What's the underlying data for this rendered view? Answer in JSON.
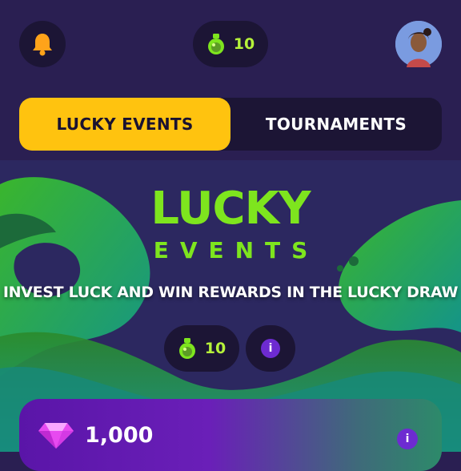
{
  "header": {
    "potion_count": "10",
    "icons": {
      "notifications": "bell-icon",
      "potion": "potion-icon",
      "avatar": "user-avatar"
    }
  },
  "tabs": [
    {
      "label": "LUCKY EVENTS",
      "active": true
    },
    {
      "label": "TOURNAMENTS",
      "active": false
    }
  ],
  "hero": {
    "title_line1": "LUCKY",
    "title_line2": "EVENTS",
    "tagline": "INVEST LUCK AND WIN REWARDS IN THE LUCKY DRAW",
    "luck_count": "10",
    "info_label": "i"
  },
  "reward_card": {
    "amount": "1,000",
    "info_label": "i",
    "icon": "gem-icon"
  },
  "colors": {
    "background": "#2a1f52",
    "panel": "#1c1535",
    "accent_yellow": "#ffc30f",
    "accent_green": "#7ee51e",
    "info_purple": "#6d2bd1"
  }
}
